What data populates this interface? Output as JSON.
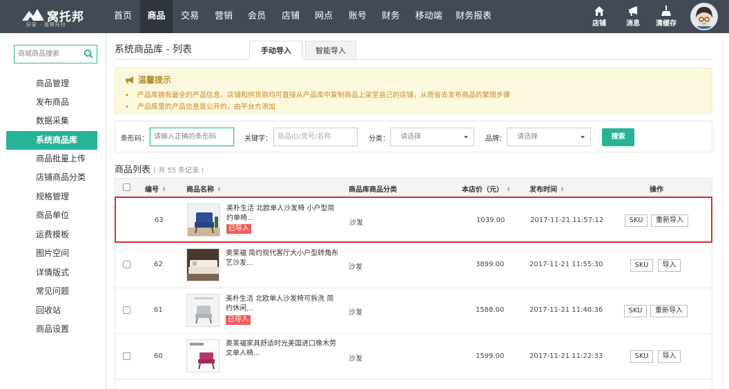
{
  "brand": {
    "name": "窝托邦",
    "slogan": "好家 · 值得托付"
  },
  "nav": [
    {
      "label": "首页",
      "active": false
    },
    {
      "label": "商品",
      "active": true
    },
    {
      "label": "交易",
      "active": false
    },
    {
      "label": "营销",
      "active": false
    },
    {
      "label": "会员",
      "active": false
    },
    {
      "label": "店铺",
      "active": false
    },
    {
      "label": "网点",
      "active": false
    },
    {
      "label": "账号",
      "active": false
    },
    {
      "label": "财务",
      "active": false
    },
    {
      "label": "移动端",
      "active": false
    },
    {
      "label": "财务报表",
      "active": false
    }
  ],
  "top_icons": [
    {
      "label": "店铺",
      "icon": "home-icon"
    },
    {
      "label": "消息",
      "icon": "megaphone-icon"
    },
    {
      "label": "清缓存",
      "icon": "broom-icon"
    }
  ],
  "sidebar": {
    "search_placeholder": "商城商品搜索",
    "items": [
      {
        "label": "商品管理",
        "active": false
      },
      {
        "label": "发布商品",
        "active": false
      },
      {
        "label": "数据采集",
        "active": false
      },
      {
        "label": "系统商品库",
        "active": true
      },
      {
        "label": "商品批量上传",
        "active": false
      },
      {
        "label": "店铺商品分类",
        "active": false
      },
      {
        "label": "规格管理",
        "active": false
      },
      {
        "label": "商品单位",
        "active": false
      },
      {
        "label": "运费模板",
        "active": false
      },
      {
        "label": "图片空间",
        "active": false
      },
      {
        "label": "详情版式",
        "active": false
      },
      {
        "label": "常见问题",
        "active": false
      },
      {
        "label": "回收站",
        "active": false
      },
      {
        "label": "商品设置",
        "active": false
      }
    ]
  },
  "page": {
    "title": "系统商品库 - 列表",
    "tabs": [
      {
        "label": "手动导入",
        "active": true
      },
      {
        "label": "智能导入",
        "active": false
      }
    ]
  },
  "notice": {
    "title": "温馨提示",
    "items": [
      "产品库拥有最全的产品信息，店铺和供货商均可直接从产品库中复制商品上架至自己的店铺，从而省去发布商品的繁琐步骤",
      "产品库里的产品信息是公开的，由平台方添加"
    ]
  },
  "filter": {
    "barcode_label": "条形码：",
    "barcode_placeholder": "请输入正确的条形码",
    "keyword_label": "关键字：",
    "keyword_placeholder": "商品ID/货号/名称",
    "category_label": "分类：",
    "category_placeholder": "请选择",
    "brand_label": "品牌：",
    "brand_placeholder": "请选择",
    "search_button": "搜索"
  },
  "list": {
    "title": "商品列表",
    "count_text": "( 共 55 条记录 )",
    "columns": {
      "id": "编号",
      "name": "商品名称",
      "category": "商品库商品分类",
      "price": "本店价（元）",
      "time": "发布时间",
      "ops": "操作"
    },
    "rows": [
      {
        "id": "63",
        "name": "美朴生活 北欧单人沙发椅 小户型简约单椅...",
        "imported": true,
        "badge": "已导入",
        "category": "沙发",
        "price": "1039.00",
        "time": "2017-11-21 11:57:12",
        "ops": [
          "SKU",
          "重新导入"
        ],
        "highlight": true
      },
      {
        "id": "62",
        "name": "奥莱福 简约现代客厅大小户型转角布艺沙发...",
        "imported": false,
        "badge": "",
        "category": "沙发",
        "price": "3899.00",
        "time": "2017-11-21 11:55:30",
        "ops": [
          "SKU",
          "导入"
        ],
        "highlight": false
      },
      {
        "id": "61",
        "name": "美朴生活 北欧单人沙发椅可拆洗 简约休闲...",
        "imported": true,
        "badge": "已导入",
        "category": "沙发",
        "price": "1588.00",
        "time": "2017-11-21 11:40:36",
        "ops": [
          "SKU",
          "重新导入"
        ],
        "highlight": false
      },
      {
        "id": "60",
        "name": "奥莱福家具舒适时光美国进口橡木劳文单人椅...",
        "imported": false,
        "badge": "",
        "category": "沙发",
        "price": "1599.00",
        "time": "2017-11-21 11:22:33",
        "ops": [
          "SKU",
          "导入"
        ],
        "highlight": false
      }
    ]
  },
  "colors": {
    "topbar": "#424a55",
    "accent": "#26b397",
    "badge": "#f35a5a",
    "highlight": "#e02a2a"
  }
}
